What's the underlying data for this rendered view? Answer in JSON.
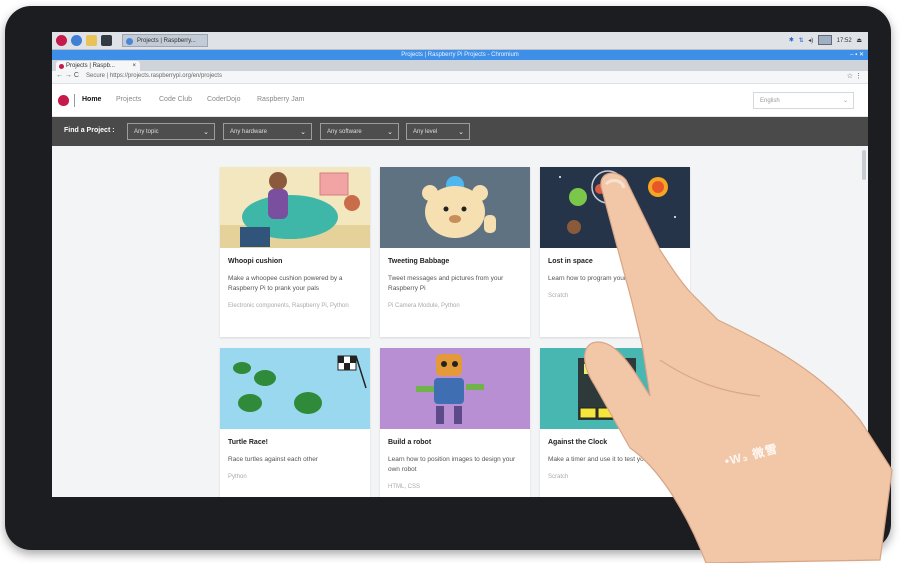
{
  "taskbar": {
    "task_label": "Projects | Raspberry...",
    "clock": "17:52"
  },
  "window": {
    "title": "Projects | Raspberry Pi Projects - Chromium",
    "controls": "– ▪ ✕"
  },
  "browser": {
    "tab_label": "Projects | Raspb...",
    "tab_close": "×",
    "nav_buttons": "← → C",
    "url": "Secure | https://projects.raspberrypi.org/en/projects",
    "menu": "☆ ⋮"
  },
  "site": {
    "nav": [
      {
        "label": "Home"
      },
      {
        "label": "Projects"
      },
      {
        "label": "Code Club"
      },
      {
        "label": "CoderDojo"
      },
      {
        "label": "Raspberry Jam"
      }
    ],
    "language": "English",
    "chevron": "⌄"
  },
  "filters": {
    "title": "Find a Project :",
    "dropdowns": [
      {
        "label": "Any topic"
      },
      {
        "label": "Any hardware"
      },
      {
        "label": "Any software"
      },
      {
        "label": "Any level"
      }
    ]
  },
  "cards": [
    {
      "title": "Whoopi cushion",
      "desc": "Make a whoopee cushion powered by a Raspberry Pi to prank your pals",
      "tags": "Electronic components, Raspberry Pi, Python",
      "img_color": "#f3e7bf"
    },
    {
      "title": "Tweeting Babbage",
      "desc": "Tweet messages and pictures from your Raspberry Pi",
      "tags": "Pi Camera Module, Python",
      "img_color": "#7a8b9c"
    },
    {
      "title": "Lost in space",
      "desc": "Learn how to program your own animations",
      "tags": "Scratch",
      "img_color": "#26344a"
    },
    {
      "title": "Turtle Race!",
      "desc": "Race turtles against each other",
      "tags": "Python",
      "img_color": "#9ad8ef"
    },
    {
      "title": "Build a robot",
      "desc": "Learn how to position images to design your own robot",
      "tags": "HTML, CSS",
      "img_color": "#b88fd3"
    },
    {
      "title": "Against the Clock",
      "desc": "Make a timer and use it to test your friends",
      "tags": "Scratch",
      "img_color": "#48b7b2"
    }
  ],
  "watermark": "•W₃ 微雪"
}
